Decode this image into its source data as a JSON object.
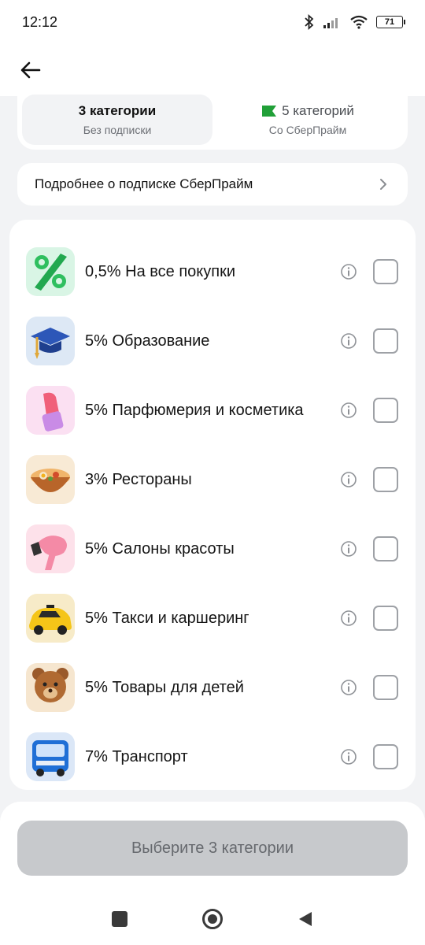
{
  "status_bar": {
    "time": "12:12",
    "battery": "71"
  },
  "tabs": [
    {
      "title": "3 категории",
      "subtitle": "Без подписки",
      "active": true
    },
    {
      "title": "5 категорий",
      "subtitle": "Со СберПрайм",
      "active": false
    }
  ],
  "more_link": {
    "label": "Подробнее о подписке СберПрайм"
  },
  "categories": [
    {
      "label": "0,5% На все покупки",
      "icon": "percent-icon"
    },
    {
      "label": "5% Образование",
      "icon": "graduation-cap-icon"
    },
    {
      "label": "5% Парфюмерия и косметика",
      "icon": "lipstick-icon"
    },
    {
      "label": "3% Рестораны",
      "icon": "food-bowl-icon"
    },
    {
      "label": "5% Салоны красоты",
      "icon": "hair-dryer-icon"
    },
    {
      "label": "5% Такси и каршеринг",
      "icon": "taxi-car-icon"
    },
    {
      "label": "5% Товары для детей",
      "icon": "teddy-bear-icon"
    },
    {
      "label": "7% Транспорт",
      "icon": "bus-icon"
    }
  ],
  "cta": {
    "label": "Выберите 3 категории"
  },
  "colors": {
    "accent_green": "#21a038",
    "disabled_button": "#c7c9cc"
  }
}
